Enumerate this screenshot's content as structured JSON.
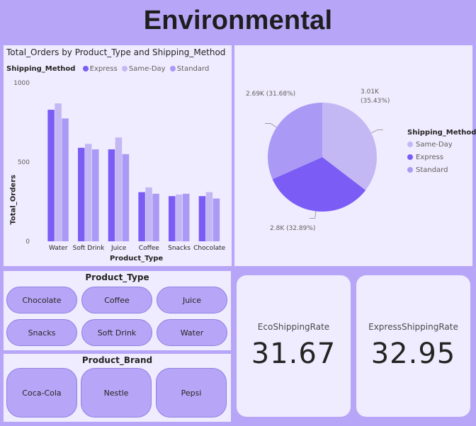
{
  "header": {
    "title": "Environmental"
  },
  "colors": {
    "express": "#7b5cf5",
    "same_day": "#c4b8f4",
    "standard": "#ab9af5",
    "background": "#b7a6f7",
    "panel": "#f0ecff"
  },
  "bar_panel": {
    "title": "Total_Orders by Product_Type and Shipping_Method",
    "legend_title": "Shipping_Method",
    "legend": [
      "Express",
      "Same-Day",
      "Standard"
    ]
  },
  "pie_panel": {
    "legend_title": "Shipping_Method",
    "legend": [
      "Same-Day",
      "Express",
      "Standard"
    ],
    "labels": {
      "standard": "2.69K (31.68%)",
      "same_day_value": "3.01K",
      "same_day_pct": "(35.43%)",
      "express": "2.8K (32.89%)"
    }
  },
  "chart_data": [
    {
      "type": "bar",
      "title": "Total_Orders by Product_Type and Shipping_Method",
      "xlabel": "Product_Type",
      "ylabel": "Total_Orders",
      "ylim": [
        0,
        1000
      ],
      "yticks": [
        "0",
        "500",
        "1000"
      ],
      "categories": [
        "Water",
        "Soft Drink",
        "Juice",
        "Coffee",
        "Snacks",
        "Chocolate"
      ],
      "series": [
        {
          "name": "Express",
          "values": [
            830,
            590,
            580,
            310,
            285,
            285
          ]
        },
        {
          "name": "Same-Day",
          "values": [
            870,
            615,
            655,
            340,
            295,
            310
          ]
        },
        {
          "name": "Standard",
          "values": [
            775,
            580,
            550,
            300,
            300,
            270
          ]
        }
      ],
      "legend": "top-left",
      "grid": false
    },
    {
      "type": "pie",
      "legend": "right",
      "slices": [
        {
          "name": "Same-Day",
          "value": 3010,
          "percent": 35.43
        },
        {
          "name": "Express",
          "value": 2800,
          "percent": 32.89
        },
        {
          "name": "Standard",
          "value": 2690,
          "percent": 31.68
        }
      ]
    }
  ],
  "product_type": {
    "title": "Product_Type",
    "options": [
      "Chocolate",
      "Coffee",
      "Juice",
      "Snacks",
      "Soft Drink",
      "Water"
    ]
  },
  "product_brand": {
    "title": "Product_Brand",
    "options": [
      "Coca-Cola",
      "Nestle",
      "Pepsi"
    ]
  },
  "kpis": [
    {
      "label": "EcoShippingRate",
      "value": "31.67"
    },
    {
      "label": "ExpressShippingRate",
      "value": "32.95"
    }
  ]
}
